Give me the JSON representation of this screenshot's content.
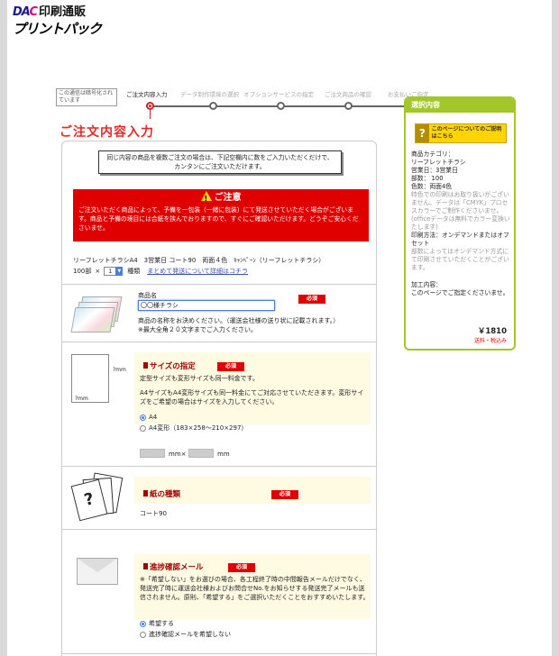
{
  "logo": {
    "brand": "DAC",
    "sub": "印刷通販",
    "name": "プリントパック"
  },
  "steps": {
    "note": "この通信は暗号化されています",
    "items": [
      "ご注文内容入力",
      "データ制作環境の選択",
      "オプションサービスの指定",
      "ご注文商品の確認",
      "お支払いご指定"
    ],
    "active_index": 0
  },
  "page_title": "ご注文内容入力",
  "intro": "同じ内容の商品を複数ご注文の場合は、下記空欄内に数をご入力いただくだけで、カンタンにご注文いただけます。",
  "alert": {
    "title": "ご注意",
    "body": "ご注文いただく商品によって、予備を一包装（一緒に包装）にて発送させていただく場合がございます。商品と予備の境目には合紙を挟んでおりますので、すぐにご確認いただけます。どうぞご安心くださいませ。"
  },
  "summary": {
    "line1": "リーフレットチラシA4　3営業日 コート90　両面４色　ｷｬﾝﾍﾟｰﾝ（リーフレットチラシ）",
    "qty_label": "100部",
    "times": "×",
    "kinds_value": "1",
    "kinds_label": "種類",
    "link": "まとめて発送について詳細はコチラ"
  },
  "product_name": {
    "label": "商品名",
    "value": "〇〇様チラシ",
    "required": "必須",
    "help1": "商品の名称をお決めください。（運送会社様の送り状に記載されます。）",
    "help2": "※最大全角２０文字までご入力ください。"
  },
  "size": {
    "title": "サイズの指定",
    "required": "必須",
    "line1": "定型サイズも変形サイズも同一料金です。",
    "line2": "A4サイズもA4変形サイズも同一料金にてご対応させていただきます。変形サイズをご希望の場合はサイズを入力してください。",
    "options": [
      "A4",
      "A4変形（183×258～210×297）"
    ],
    "selected": 0,
    "unit_mm_x": "mm×",
    "unit_mm": "mm",
    "dim_w": "?mm",
    "dim_h": "?mm"
  },
  "paper": {
    "title": "紙の種類",
    "required": "必須",
    "value": "コート90"
  },
  "progress_mail": {
    "title": "進捗確認メール",
    "required": "必須",
    "body": "※「希望しない」をお選びの場合、各工程終了時の中間報告メールだけでなく、発送完了時に運送会社様およびお問合せNo.をお知らせする発送完了メールも送信されません。原則、「希望する」をご選択いただくことをおすすめいたします。",
    "options": [
      "希望する",
      "進捗確認メールを希望しない"
    ],
    "selected": 0
  },
  "sidebar": {
    "title": "選択内容",
    "help_button": "このページについてのご説明はこちら",
    "category_label": "商品カテゴリ：",
    "category": "リーフレットチラシ",
    "days": "営業日：3営業日",
    "copies": "部数： 100",
    "colors": "色数：両面4色",
    "note1": "特色での印刷はお取り扱いがございません。データは「CMYK」プロセスカラーでご制作くださいませ。(officeデータは無料でカラー変換いたします)",
    "method": "印刷方法：オンデマンドまたはオフセット",
    "note2": "部数によってはオンデマンド方式にて印刷させていただくことがございます。",
    "processing_label": "加工内容：",
    "processing": "このページでご指定くださいませ。",
    "price": "￥1810",
    "price_note": "送料・税込み"
  },
  "colors": {
    "accent_red": "#e00000",
    "title_red": "#e52a2a",
    "side_green": "#a3c72a",
    "help_yellow": "#ffd400"
  }
}
